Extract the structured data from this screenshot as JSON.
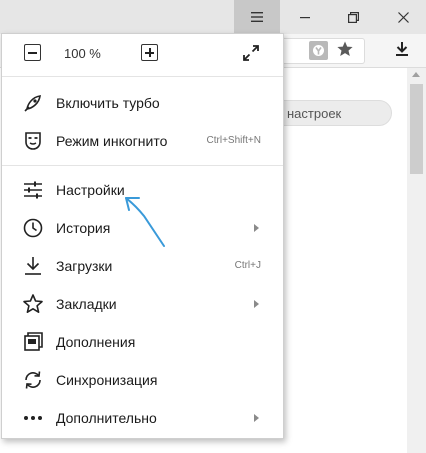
{
  "window": {
    "menu_icon": "hamburger-icon",
    "minimize_icon": "minimize-icon",
    "restore_icon": "restore-icon",
    "close_icon": "close-icon"
  },
  "toolbar": {
    "protect_icon": "protect-shield-icon",
    "bookmark_icon": "star-icon",
    "download_icon": "download-icon"
  },
  "page": {
    "search_placeholder": "настроек"
  },
  "menu": {
    "zoom": {
      "value": "100 %"
    },
    "items": [
      {
        "label": "Включить турбо",
        "icon": "rocket-icon"
      },
      {
        "label": "Режим инкогнито",
        "shortcut": "Ctrl+Shift+N",
        "icon": "incognito-mask-icon"
      },
      {
        "label": "Настройки",
        "icon": "settings-sliders-icon"
      },
      {
        "label": "История",
        "icon": "clock-icon",
        "submenu": true
      },
      {
        "label": "Загрузки",
        "shortcut": "Ctrl+J",
        "icon": "download-icon"
      },
      {
        "label": "Закладки",
        "icon": "star-outline-icon",
        "submenu": true
      },
      {
        "label": "Дополнения",
        "icon": "extensions-icon"
      },
      {
        "label": "Синхронизация",
        "icon": "sync-icon"
      },
      {
        "label": "Дополнительно",
        "icon": "more-dots-icon",
        "submenu": true
      }
    ]
  },
  "annotation": {
    "color": "#3a9ad9",
    "icon": "pointer-arrow"
  },
  "colors": {
    "titlebar": "#e6e6e6",
    "menu_button_active": "#c8c8c8",
    "menu_bg": "#ffffff"
  }
}
